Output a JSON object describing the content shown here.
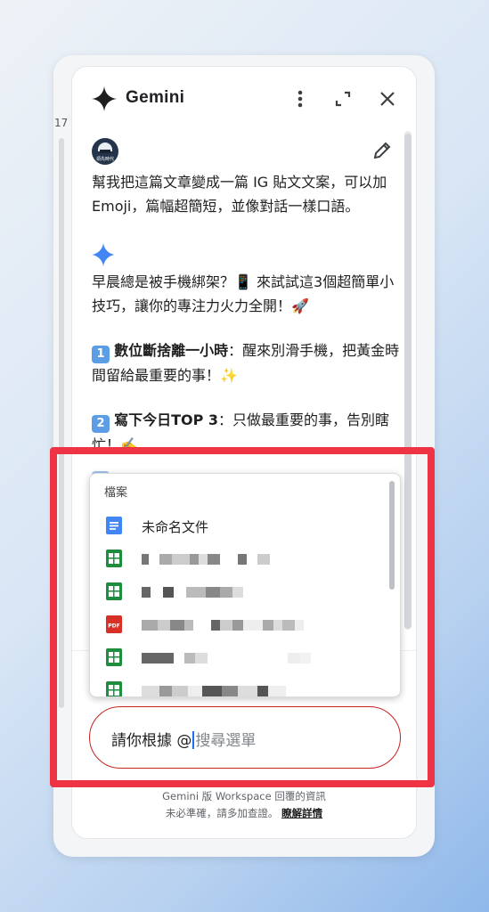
{
  "side_ruler": {
    "number": "17"
  },
  "header": {
    "title": "Gemini",
    "icons": {
      "logo": "gemini-sparkle-icon",
      "more": "more-vert-icon",
      "expand": "expand-icon",
      "close": "close-icon"
    }
  },
  "conversation": {
    "user_avatar_caption": "領先時代",
    "user_message": "幫我把這篇文章變成一篇 IG 貼文文案，可以加 Emoji，篇幅超簡短，並像對話一樣口語。",
    "response": {
      "intro": "早晨總是被手機綁架？📱 來試試這3個超簡單小技巧，讓你的專注力火力全開！🚀",
      "items": [
        {
          "badge": "1",
          "title": "數位斷捨離一小時",
          "text": "：醒來別滑手機，把黃金時間留給最重要的事！✨"
        },
        {
          "badge": "2",
          "title": "寫下今日TOP 3",
          "text": "：只做最重要的事，告別瞎忙！✍️"
        }
      ]
    }
  },
  "dropdown": {
    "header": "檔案",
    "items": [
      {
        "type": "doc",
        "name": "未命名文件"
      },
      {
        "type": "sheet",
        "name": ""
      },
      {
        "type": "sheet",
        "name": ""
      },
      {
        "type": "pdf",
        "name": ""
      },
      {
        "type": "sheet",
        "name": ""
      },
      {
        "type": "sheet",
        "name": ""
      }
    ],
    "pdf_icon_text": "PDF"
  },
  "input": {
    "typed": "請你根據 @",
    "placeholder": "搜尋選單"
  },
  "disclaimer": {
    "line1": "Gemini 版 Workspace 回覆的資訊",
    "line2": "未必準確，請多加查證。",
    "learn_more": "瞭解詳情"
  },
  "colors": {
    "highlight": "#ee3344",
    "gemini_blue": "#4285f4",
    "sheet_green": "#1e8e3e",
    "pdf_red": "#d93025",
    "input_border": "#c5221f"
  }
}
